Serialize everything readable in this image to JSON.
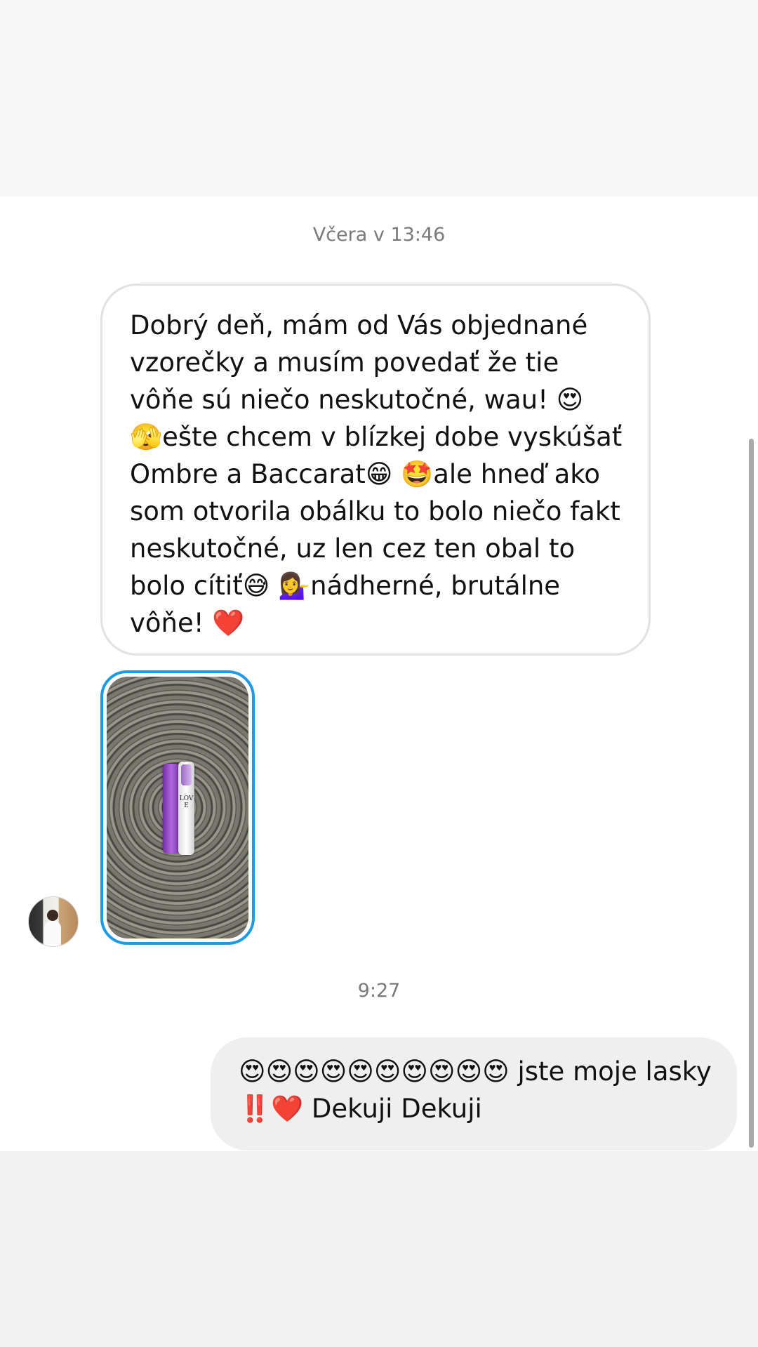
{
  "conversation": {
    "timestamps": [
      "Včera v 13:46",
      "9:27"
    ],
    "incoming_message": "Dobrý deň, mám od Vás objednané vzorečky a musím povedať že tie vôňe sú niečo neskutočné, wau! 😍 🫣ešte chcem v blízkej dobe vyskúšať Ombre a Baccarat😁 🤩ale hneď ako som otvorila obálku to bolo niečo fakt neskutočné, uz len cez ten obal to bolo cítiť😅 💁‍♀️nádherné, brutálne vôňe! ❤️",
    "photo": {
      "vial_label": "LOVE"
    },
    "outgoing_message": "😍😍😍😍😍😍😍😍😍😍 jste moje lasky ‼️❤️ Dekuji Dekuji"
  }
}
